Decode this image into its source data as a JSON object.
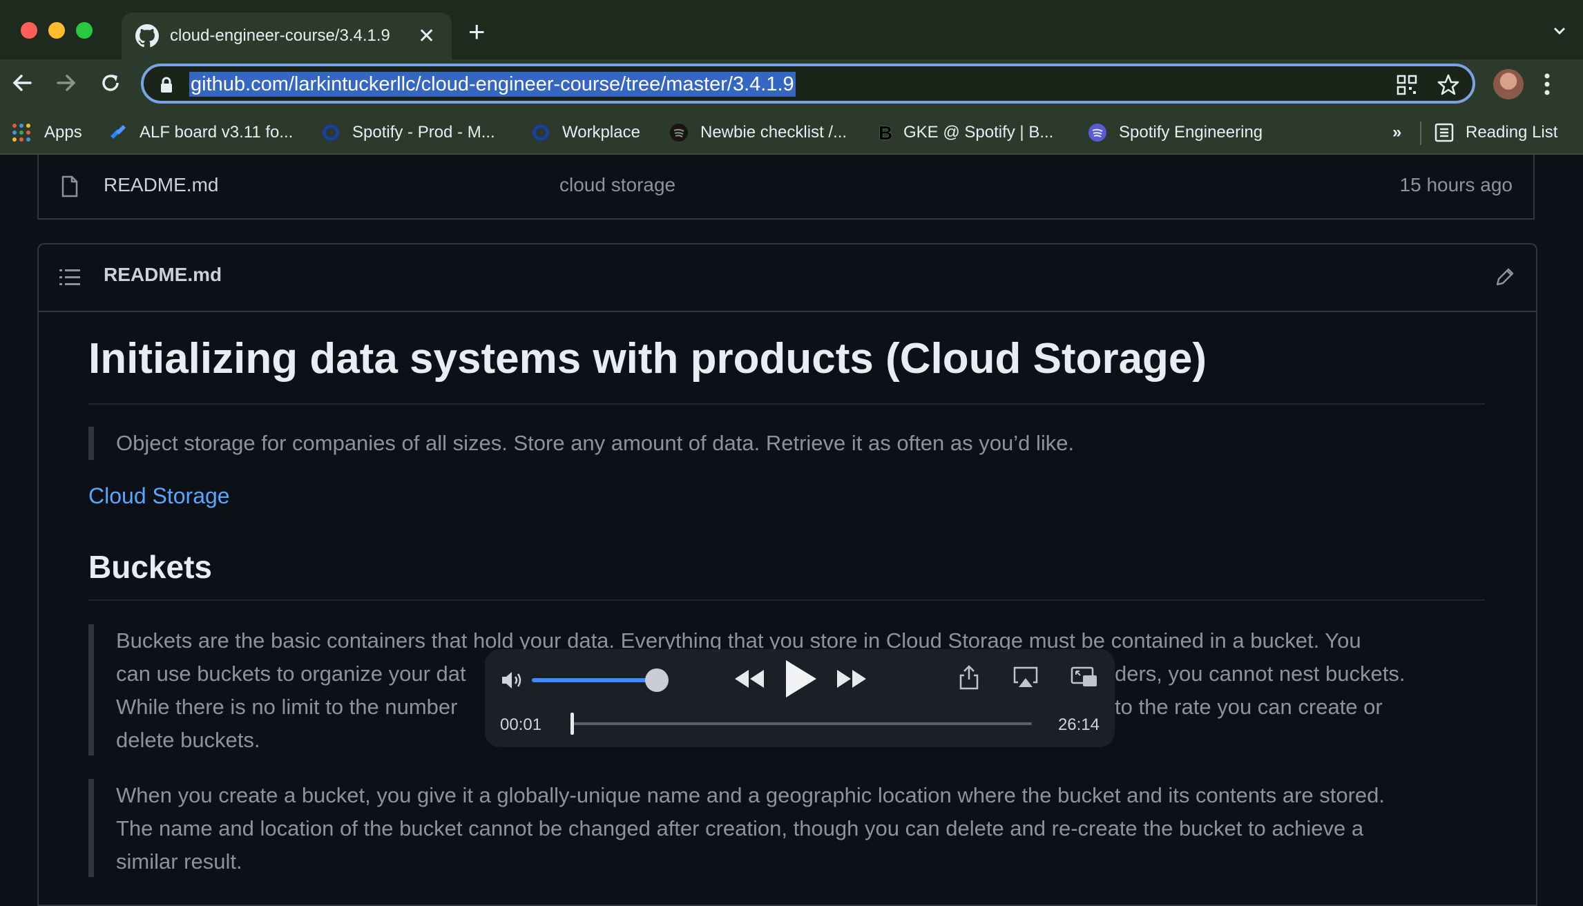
{
  "browser": {
    "tab_title": "cloud-engineer-course/3.4.1.9",
    "url": "github.com/larkintuckerllc/cloud-engineer-course/tree/master/3.4.1.9",
    "bookmarks": [
      {
        "label": "Apps",
        "icon": "apps-grid-icon"
      },
      {
        "label": "ALF board v3.11 fo...",
        "icon": "jira-icon"
      },
      {
        "label": "Spotify - Prod - M...",
        "icon": "ring-icon"
      },
      {
        "label": "Workplace",
        "icon": "ring-icon"
      },
      {
        "label": "Newbie checklist /...",
        "icon": "spotify-icon"
      },
      {
        "label": "GKE @ Spotify | B...",
        "icon": "backstage-icon"
      },
      {
        "label": "Spotify Engineering",
        "icon": "spotify-icon"
      }
    ],
    "more_bookmarks": "»",
    "reading_list": "Reading List"
  },
  "file_row": {
    "name": "README.md",
    "message": "cloud storage",
    "age": "15 hours ago"
  },
  "readme": {
    "header": "README.md",
    "title": "Initializing data systems with products (Cloud Storage)",
    "quote": "Object storage for companies of all sizes. Store any amount of data. Retrieve it as often as you’d like.",
    "link": "Cloud Storage",
    "h2": "Buckets",
    "p1_lines": [
      "Buckets are the basic containers that hold your data. Everything that you store in Cloud Storage must be contained in a bucket. You",
      "can use buckets to organize your dat",
      "While there is no limit to the number",
      "delete buckets."
    ],
    "p1_right_lines": [
      "ders, you cannot nest buckets.",
      "to the rate you can create or"
    ],
    "p2_lines": [
      "When you create a bucket, you give it a globally-unique name and a geographic location where the bucket and its contents are stored.",
      "The name and location of the bucket cannot be changed after creation, though you can delete and re-create the bucket to achieve a",
      "similar result."
    ]
  },
  "player": {
    "current_time": "00:01",
    "duration": "26:14",
    "volume_fraction": 0.9,
    "progress_fraction": 0.0
  },
  "colors": {
    "accent_blue": "#3d8bff",
    "link_blue": "#58a6ff",
    "background": "#0d1117"
  }
}
